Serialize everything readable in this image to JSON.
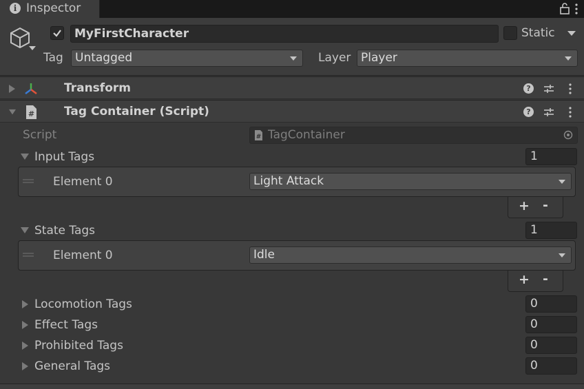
{
  "window": {
    "tab_title": "Inspector"
  },
  "header": {
    "object_name": "MyFirstCharacter",
    "active": true,
    "static_label": "Static",
    "static_checked": false,
    "tag_label": "Tag",
    "tag_value": "Untagged",
    "layer_label": "Layer",
    "layer_value": "Player"
  },
  "components": [
    {
      "title": "Transform",
      "expanded": false,
      "icon": "transform-axes-icon"
    },
    {
      "title": "Tag Container (Script)",
      "expanded": true,
      "icon": "csharp-script-icon"
    }
  ],
  "tag_container": {
    "script_label": "Script",
    "script_value": "TagContainer",
    "lists": [
      {
        "label": "Input Tags",
        "expanded": true,
        "size": "1",
        "elements": [
          {
            "label": "Element 0",
            "value": "Light Attack"
          }
        ]
      },
      {
        "label": "State Tags",
        "expanded": true,
        "size": "1",
        "elements": [
          {
            "label": "Element 0",
            "value": "Idle"
          }
        ]
      },
      {
        "label": "Locomotion Tags",
        "expanded": false,
        "size": "0"
      },
      {
        "label": "Effect Tags",
        "expanded": false,
        "size": "0"
      },
      {
        "label": "Prohibited Tags",
        "expanded": false,
        "size": "0"
      },
      {
        "label": "General Tags",
        "expanded": false,
        "size": "0"
      }
    ],
    "add_label": "+",
    "remove_label": "-"
  },
  "colors": {
    "background": "#383838",
    "header": "#3e3e3e",
    "field": "#2a2a2a",
    "dropdown": "#505050",
    "text": "#c4c4c4"
  }
}
